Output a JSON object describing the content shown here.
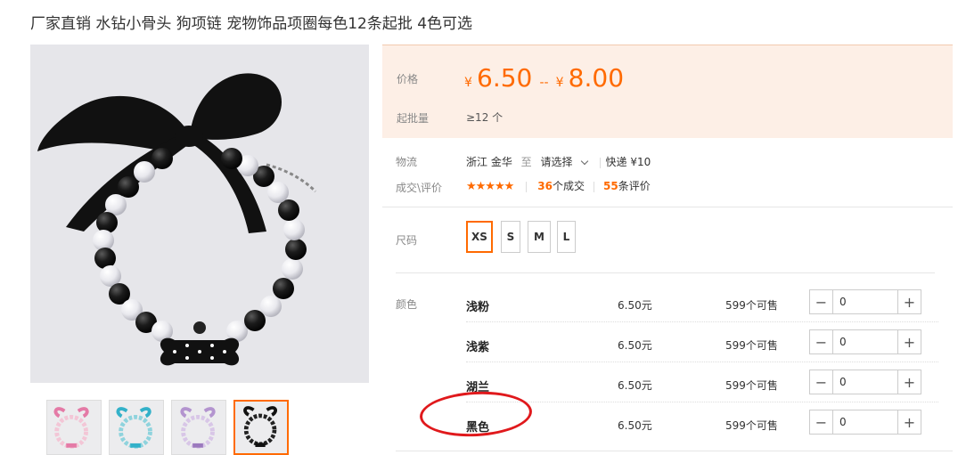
{
  "product": {
    "title": "厂家直销 水钻小骨头 狗项链 宠物饰品项圈每色12条起批 4色可选"
  },
  "price_box": {
    "price_label": "价格",
    "currency": "¥",
    "price_min": "6.50",
    "price_sep": "--",
    "price_max": "8.00",
    "moq_label": "起批量",
    "moq_value": "≥12 个"
  },
  "logistics": {
    "label": "物流",
    "origin": "浙江 金华",
    "to": "至",
    "destination": "请选择",
    "shipping": "快递 ¥10"
  },
  "deals": {
    "label": "成交\\评价",
    "stars": "★★★★★",
    "deal_count": "36",
    "deal_suffix": "个成交",
    "review_count": "55",
    "review_suffix": "条评价"
  },
  "sizes": {
    "label": "尺码",
    "options": [
      "XS",
      "S",
      "M",
      "L"
    ],
    "selected": "XS"
  },
  "colors": {
    "label": "颜色",
    "items": [
      {
        "name": "浅粉",
        "price": "6.50元",
        "stock": "599个可售",
        "qty": "0"
      },
      {
        "name": "浅紫",
        "price": "6.50元",
        "stock": "599个可售",
        "qty": "0"
      },
      {
        "name": "湖兰",
        "price": "6.50元",
        "stock": "599个可售",
        "qty": "0"
      },
      {
        "name": "黑色",
        "price": "6.50元",
        "stock": "599个可售",
        "qty": "0"
      }
    ]
  },
  "icons": {
    "minus": "−",
    "plus": "+"
  },
  "theme": {
    "accent": "#ff6a00",
    "price_bg": "#fdefe6",
    "annotation_red": "#e0191c"
  }
}
